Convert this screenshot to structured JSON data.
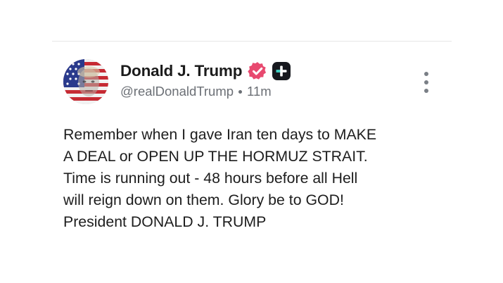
{
  "post": {
    "author": {
      "display_name": "Donald J. Trump",
      "handle": "@realDonaldTrump",
      "verified_icon": "verified-check-icon",
      "badge_icon": "plus-badge-icon",
      "avatar": "avatar-image"
    },
    "timestamp": "11m",
    "body": "Remember when I gave Iran ten days to MAKE\nA DEAL or OPEN UP THE HORMUZ STRAIT.\nTime is running out - 48 hours before all Hell\nwill reign down on them. Glory be to GOD!\nPresident DONALD J. TRUMP",
    "more_menu_icon": "more-vertical-icon"
  },
  "colors": {
    "verified_badge": "#e8496f",
    "plus_badge": "#17191f",
    "secondary_text": "#6b6f75",
    "divider": "#e6e6e6"
  }
}
